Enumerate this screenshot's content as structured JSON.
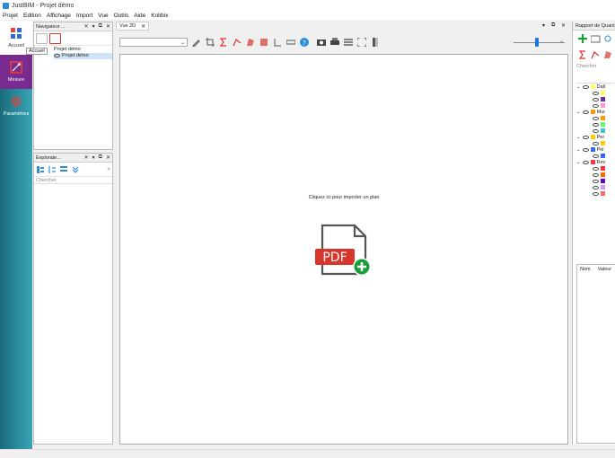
{
  "window": {
    "title": "JustBIM - Projet démo"
  },
  "menu": [
    "Projet",
    "Edition",
    "Affichage",
    "Import",
    "Vue",
    "Outils",
    "Aide",
    "Kolibix"
  ],
  "sidebar": {
    "items": [
      {
        "label": "Accueil",
        "icon": "grid-icon"
      },
      {
        "label": "Mesure",
        "icon": "measure-icon"
      },
      {
        "label": "Paramètres",
        "icon": "gear-icon"
      }
    ],
    "tooltip": "Accueil"
  },
  "navigator": {
    "title": "Navigateur ...",
    "tree": [
      "Projet démo",
      "Projet démo"
    ]
  },
  "explorer": {
    "title": "Explorate...",
    "search_placeholder": "Chercher"
  },
  "document_tab": {
    "label": "Vue 2D"
  },
  "canvas": {
    "import_prompt": "Cliquez ici pour importer un plan",
    "pdf_label": "PDF"
  },
  "report": {
    "title": "Rapport de Quantit...",
    "search_placeholder": "Chercher",
    "groups": [
      {
        "label": "Dall",
        "colors": [
          "#ffff66",
          "#7030a0",
          "#ff99cc"
        ]
      },
      {
        "label": "Mur",
        "colors": [
          "#ff9900",
          "#66ff66",
          "#33cccc"
        ]
      },
      {
        "label": "Per",
        "colors": [
          "#ffcc00"
        ]
      },
      {
        "label": "Piè",
        "colors": [
          "#3366ff"
        ]
      },
      {
        "label": "Rev",
        "colors": [
          "#ff3333",
          "#ff6600",
          "#6600cc",
          "#cc99ff",
          "#ff6666"
        ]
      }
    ],
    "columns": [
      "Nom",
      "Valeur"
    ]
  },
  "colors": {
    "accent": "#1e78d7",
    "sidebar": "#2b8fa0",
    "mesure_active": "#7a2b8f",
    "pdf_red": "#d9362b",
    "pdf_green": "#1a9e3a"
  }
}
